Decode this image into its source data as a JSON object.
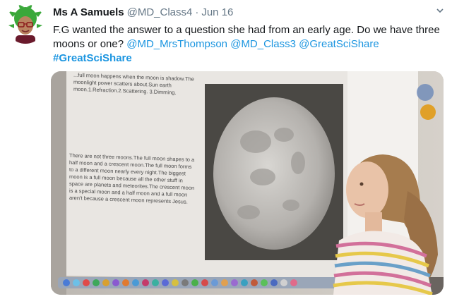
{
  "tweet": {
    "author_name": "Ms A Samuels",
    "handle": "@MD_Class4",
    "separator": "·",
    "date": "Jun 16",
    "text_main": "F.G wanted the answer to a question she had from an early age. Do we have three moons or one?",
    "mentions": [
      "@MD_MrsThompson",
      "@MD_Class3",
      "@GreatSciShare"
    ],
    "hashtag": "#GreatSciShare"
  },
  "media": {
    "board_text_top": "...full moon happens when the moon is shadow.The moonlight power scatters about.Sun earth moon.1.Refraction.2.Scattering. 3.Dimming.",
    "board_text_bottom": "There are not three moons.The full moon shapes to a half moon and a crescent moon.The full moon forms to a different moon nearly every night.The biggest moon is a full moon because all the other stuff in space are planets and meteorites.The crescent moon is a special moon and a half moon and a full moon aren't because a crescent moon represents Jesus."
  },
  "colors": {
    "link": "#1b95e0",
    "name": "#14171a",
    "muted": "#657786"
  },
  "icons": {
    "caret": "chevron-down-icon",
    "avatar": "bitmoji-avatar"
  }
}
